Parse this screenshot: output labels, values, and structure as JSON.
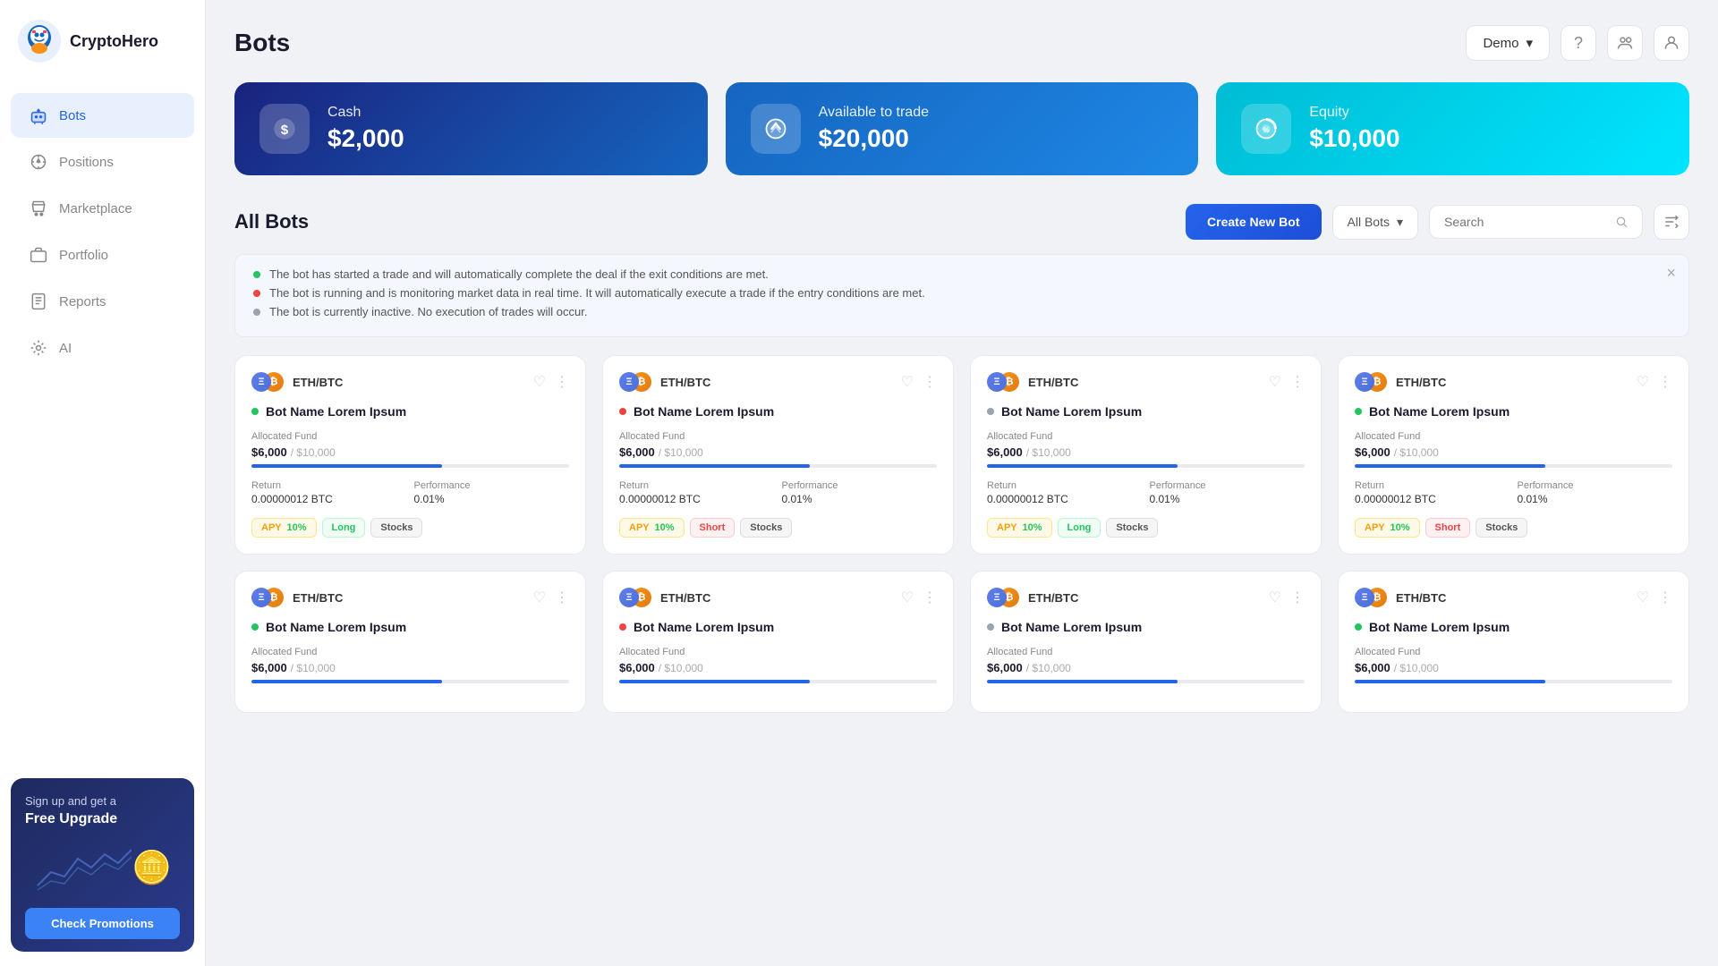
{
  "sidebar": {
    "logo_text": "CryptoHero",
    "nav_items": [
      {
        "id": "bots",
        "label": "Bots",
        "icon": "🤖",
        "active": true
      },
      {
        "id": "positions",
        "label": "Positions",
        "icon": "📊",
        "active": false
      },
      {
        "id": "marketplace",
        "label": "Marketplace",
        "icon": "🏪",
        "active": false
      },
      {
        "id": "portfolio",
        "label": "Portfolio",
        "icon": "💼",
        "active": false
      },
      {
        "id": "reports",
        "label": "Reports",
        "icon": "📋",
        "active": false
      },
      {
        "id": "ai",
        "label": "AI",
        "icon": "⚙️",
        "active": false
      }
    ],
    "promo": {
      "text": "Sign up and get a",
      "bold": "Free Upgrade",
      "btn_label": "Check Promotions"
    }
  },
  "header": {
    "title": "Bots",
    "demo_label": "Demo",
    "icons": {
      "help": "?",
      "group": "👥",
      "user": "👤"
    }
  },
  "stats": [
    {
      "id": "cash",
      "label": "Cash",
      "value": "$2,000",
      "icon": "$",
      "type": "cash"
    },
    {
      "id": "available",
      "label": "Available to trade",
      "value": "$20,000",
      "icon": "↺",
      "type": "available"
    },
    {
      "id": "equity",
      "label": "Equity",
      "value": "$10,000",
      "icon": "%",
      "type": "equity"
    }
  ],
  "all_bots_section": {
    "title": "All Bots",
    "create_btn": "Create New Bot",
    "filter_label": "All Bots",
    "search_placeholder": "Search",
    "info_items": [
      {
        "color": "green",
        "text": "The bot has started a trade and will automatically complete the deal if the exit conditions are met."
      },
      {
        "color": "red",
        "text": "The bot is running and is monitoring market data in real time. It will automatically execute a trade if the entry conditions are met."
      },
      {
        "color": "gray",
        "text": "The bot is currently inactive. No execution of trades will occur."
      }
    ]
  },
  "bot_cards_row1": [
    {
      "pair": "ETH/BTC",
      "status": "active",
      "name": "Bot Name Lorem Ipsum",
      "allocated_label": "Allocated Fund",
      "allocated_current": "$6,000",
      "allocated_total": "/ $10,000",
      "progress": 60,
      "return_label": "Return",
      "return_value": "0.00000012 BTC",
      "perf_label": "Performance",
      "perf_value": "0.01%",
      "tags": [
        {
          "type": "apy",
          "prefix": "APY",
          "val": "10%"
        },
        {
          "type": "long",
          "label": "Long"
        },
        {
          "type": "stocks",
          "label": "Stocks"
        }
      ]
    },
    {
      "pair": "ETH/BTC",
      "status": "running",
      "name": "Bot Name Lorem Ipsum",
      "allocated_label": "Allocated Fund",
      "allocated_current": "$6,000",
      "allocated_total": "/ $10,000",
      "progress": 60,
      "return_label": "Return",
      "return_value": "0.00000012 BTC",
      "perf_label": "Performance",
      "perf_value": "0.01%",
      "tags": [
        {
          "type": "apy",
          "prefix": "APY",
          "val": "10%"
        },
        {
          "type": "short",
          "label": "Short"
        },
        {
          "type": "stocks",
          "label": "Stocks"
        }
      ]
    },
    {
      "pair": "ETH/BTC",
      "status": "inactive",
      "name": "Bot Name Lorem Ipsum",
      "allocated_label": "Allocated Fund",
      "allocated_current": "$6,000",
      "allocated_total": "/ $10,000",
      "progress": 60,
      "return_label": "Return",
      "return_value": "0.00000012 BTC",
      "perf_label": "Performance",
      "perf_value": "0.01%",
      "tags": [
        {
          "type": "apy",
          "prefix": "APY",
          "val": "10%"
        },
        {
          "type": "long",
          "label": "Long"
        },
        {
          "type": "stocks",
          "label": "Stocks"
        }
      ]
    },
    {
      "pair": "ETH/BTC",
      "status": "active",
      "name": "Bot Name Lorem Ipsum",
      "allocated_label": "Allocated Fund",
      "allocated_current": "$6,000",
      "allocated_total": "/ $10,000",
      "progress": 60,
      "return_label": "Return",
      "return_value": "0.00000012 BTC",
      "perf_label": "Performance",
      "perf_value": "0.01%",
      "tags": [
        {
          "type": "apy",
          "prefix": "APY",
          "val": "10%"
        },
        {
          "type": "short",
          "label": "Short"
        },
        {
          "type": "stocks",
          "label": "Stocks"
        }
      ]
    }
  ],
  "bot_cards_row2": [
    {
      "pair": "ETH/BTC",
      "status": "active",
      "name": "Bot Name Lorem Ipsum",
      "allocated_label": "Allocated Fund",
      "allocated_current": "$6,000",
      "allocated_total": "/ $10,000",
      "progress": 60
    },
    {
      "pair": "ETH/BTC",
      "status": "running",
      "name": "Bot Name Lorem Ipsum",
      "allocated_label": "Allocated Fund",
      "allocated_current": "$6,000",
      "allocated_total": "/ $10,000",
      "progress": 60
    },
    {
      "pair": "ETH/BTC",
      "status": "inactive",
      "name": "Bot Name Lorem Ipsum",
      "allocated_label": "Allocated Fund",
      "allocated_current": "$6,000",
      "allocated_total": "/ $10,000",
      "progress": 60
    },
    {
      "pair": "ETH/BTC",
      "status": "active",
      "name": "Bot Name Lorem Ipsum",
      "allocated_label": "Allocated Fund",
      "allocated_current": "$6,000",
      "allocated_total": "/ $10,000",
      "progress": 60
    }
  ]
}
